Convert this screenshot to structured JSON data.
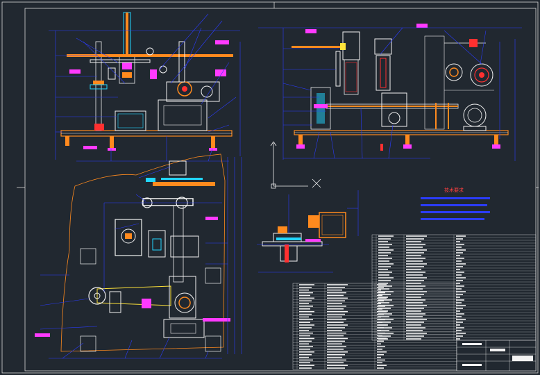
{
  "drawing": {
    "background": "#212830",
    "frame_color": "#d8d8d8",
    "colors": {
      "blue": "#2b3cff",
      "orange": "#ff8a1e",
      "white": "#f2f2f2",
      "cyan": "#22d6ff",
      "magenta": "#ff3aff",
      "red": "#ff3030",
      "green": "#2bd94a",
      "yellow": "#ffe33a"
    },
    "tech_req_title": "技术要求",
    "scale_box": "1:1",
    "sheet_no": "ZJ-01"
  }
}
